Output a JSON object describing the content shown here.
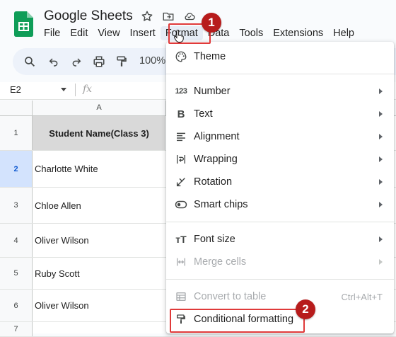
{
  "app": {
    "title": "Google Sheets",
    "brand_color": "#0f9d58"
  },
  "menubar": {
    "items": [
      {
        "label": "File"
      },
      {
        "label": "Edit"
      },
      {
        "label": "View"
      },
      {
        "label": "Insert"
      },
      {
        "label": "Format",
        "active": true
      },
      {
        "label": "Data"
      },
      {
        "label": "Tools"
      },
      {
        "label": "Extensions"
      },
      {
        "label": "Help"
      }
    ]
  },
  "toolbar": {
    "zoom": "100%",
    "icons": [
      "search-icon",
      "undo-icon",
      "redo-icon",
      "print-icon",
      "paint-format-icon"
    ]
  },
  "formula_bar": {
    "cell_ref": "E2",
    "fx_label": "fx"
  },
  "grid": {
    "column_header": "A",
    "rows": [
      {
        "num": "1",
        "value": "Student Name(Class 3)",
        "header": true
      },
      {
        "num": "2",
        "value": "Charlotte White",
        "selected": true
      },
      {
        "num": "3",
        "value": "Chloe Allen"
      },
      {
        "num": "4",
        "value": "Oliver Wilson"
      },
      {
        "num": "5",
        "value": "Ruby Scott"
      },
      {
        "num": "6",
        "value": "Oliver Wilson"
      },
      {
        "num": "7",
        "value": ""
      }
    ]
  },
  "format_menu": {
    "theme": "Theme",
    "number": "Number",
    "text": "Text",
    "alignment": "Alignment",
    "wrapping": "Wrapping",
    "rotation": "Rotation",
    "smart_chips": "Smart chips",
    "font_size": "Font size",
    "merge_cells": "Merge cells",
    "convert_to_table": "Convert to table",
    "convert_shortcut": "Ctrl+Alt+T",
    "conditional_formatting": "Conditional formatting",
    "number_icon_text": "123",
    "text_icon_text": "B",
    "font_size_icon_text": "тT"
  },
  "annotations": {
    "step1": "1",
    "step2": "2",
    "highlight_color": "#e03a3a",
    "badge_color": "#b71c1c"
  }
}
